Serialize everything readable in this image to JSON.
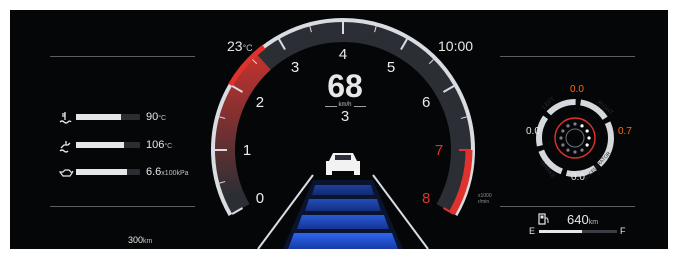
{
  "colors": {
    "background": "#050608",
    "accent_red": "#e0322c",
    "accent_orange": "#ff6a1a",
    "blue_lane": "#2f6bff",
    "text": "#e8e8e8",
    "separator": "#5a5f66"
  },
  "header": {
    "outside_temp": "23",
    "outside_temp_unit": "°C",
    "clock": "10:00"
  },
  "tachometer": {
    "ticks": [
      "0",
      "1",
      "2",
      "3",
      "4",
      "5",
      "6",
      "7",
      "8"
    ],
    "redline_start": "7",
    "unit_label": "x1000 r/min"
  },
  "speed": {
    "value": "68",
    "unit": "km/h",
    "gear": "3"
  },
  "left_gauges": [
    {
      "icon": "coolant-temp-icon",
      "value": "90",
      "unit": "°C",
      "level": 0.7
    },
    {
      "icon": "oil-temp-icon",
      "value": "106",
      "unit": "°C",
      "level": 0.75
    },
    {
      "icon": "oil-pressure-icon",
      "value": "6.6",
      "unit": "x100kPa",
      "level": 0.8
    }
  ],
  "trip": {
    "value": "300",
    "unit": "km"
  },
  "g_meter": {
    "label_left": "LEFT",
    "label_right": "RIGHT",
    "label_brake": "BRAKE",
    "label_accelerator": "ACCELERATOR",
    "left_value": "0.0",
    "top_value": "0.0",
    "right_value": "0.7",
    "bottom_value": "0.0"
  },
  "fuel": {
    "range_value": "640",
    "range_unit": "km",
    "empty_label": "E",
    "full_label": "F",
    "level": 0.55
  }
}
